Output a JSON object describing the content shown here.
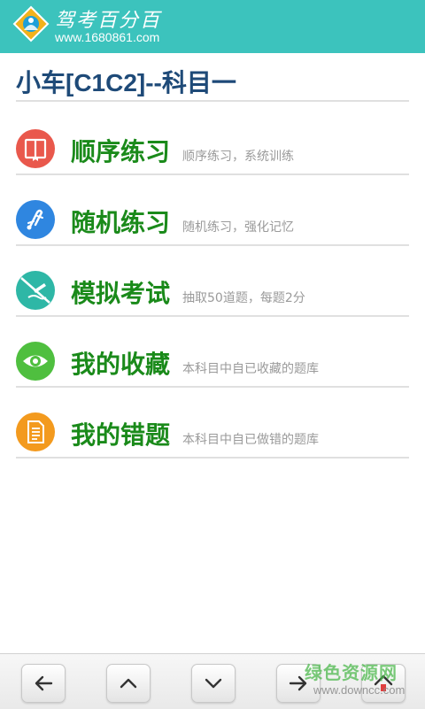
{
  "header": {
    "logo_title": "驾考百分百",
    "logo_url": "www.1680861.com",
    "background_color": "#3cc3bd"
  },
  "page": {
    "title": "小车[C1C2]--科目一"
  },
  "menu": [
    {
      "label": "顺序练习",
      "desc": "顺序练习，系统训练",
      "icon": "book-icon",
      "color": "#e9584c"
    },
    {
      "label": "随机练习",
      "desc": "随机练习，强化记忆",
      "icon": "shuffle-icon",
      "color": "#2f86e0"
    },
    {
      "label": "模拟考试",
      "desc": "抽取50道题，每题2分",
      "icon": "pen-writing-icon",
      "color": "#2eb7a6"
    },
    {
      "label": "我的收藏",
      "desc": "本科目中自已收藏的题库",
      "icon": "eye-icon",
      "color": "#4fbf3f"
    },
    {
      "label": "我的错题",
      "desc": "本科目中自已做错的题库",
      "icon": "document-icon",
      "color": "#f39a1e"
    }
  ],
  "footer": {
    "buttons": [
      {
        "name": "back-button",
        "icon": "arrow-left-icon"
      },
      {
        "name": "up-button",
        "icon": "chevron-up-icon"
      },
      {
        "name": "down-button",
        "icon": "chevron-down-icon"
      },
      {
        "name": "forward-button",
        "icon": "arrow-right-icon"
      },
      {
        "name": "home-button",
        "icon": "home-icon"
      }
    ]
  },
  "watermark": {
    "text": "绿色资源网",
    "url": "www.downcc.com"
  },
  "colors": {
    "label_green": "#1a8a1a",
    "title_blue": "#1e4a78",
    "desc_gray": "#9a9a9a"
  }
}
